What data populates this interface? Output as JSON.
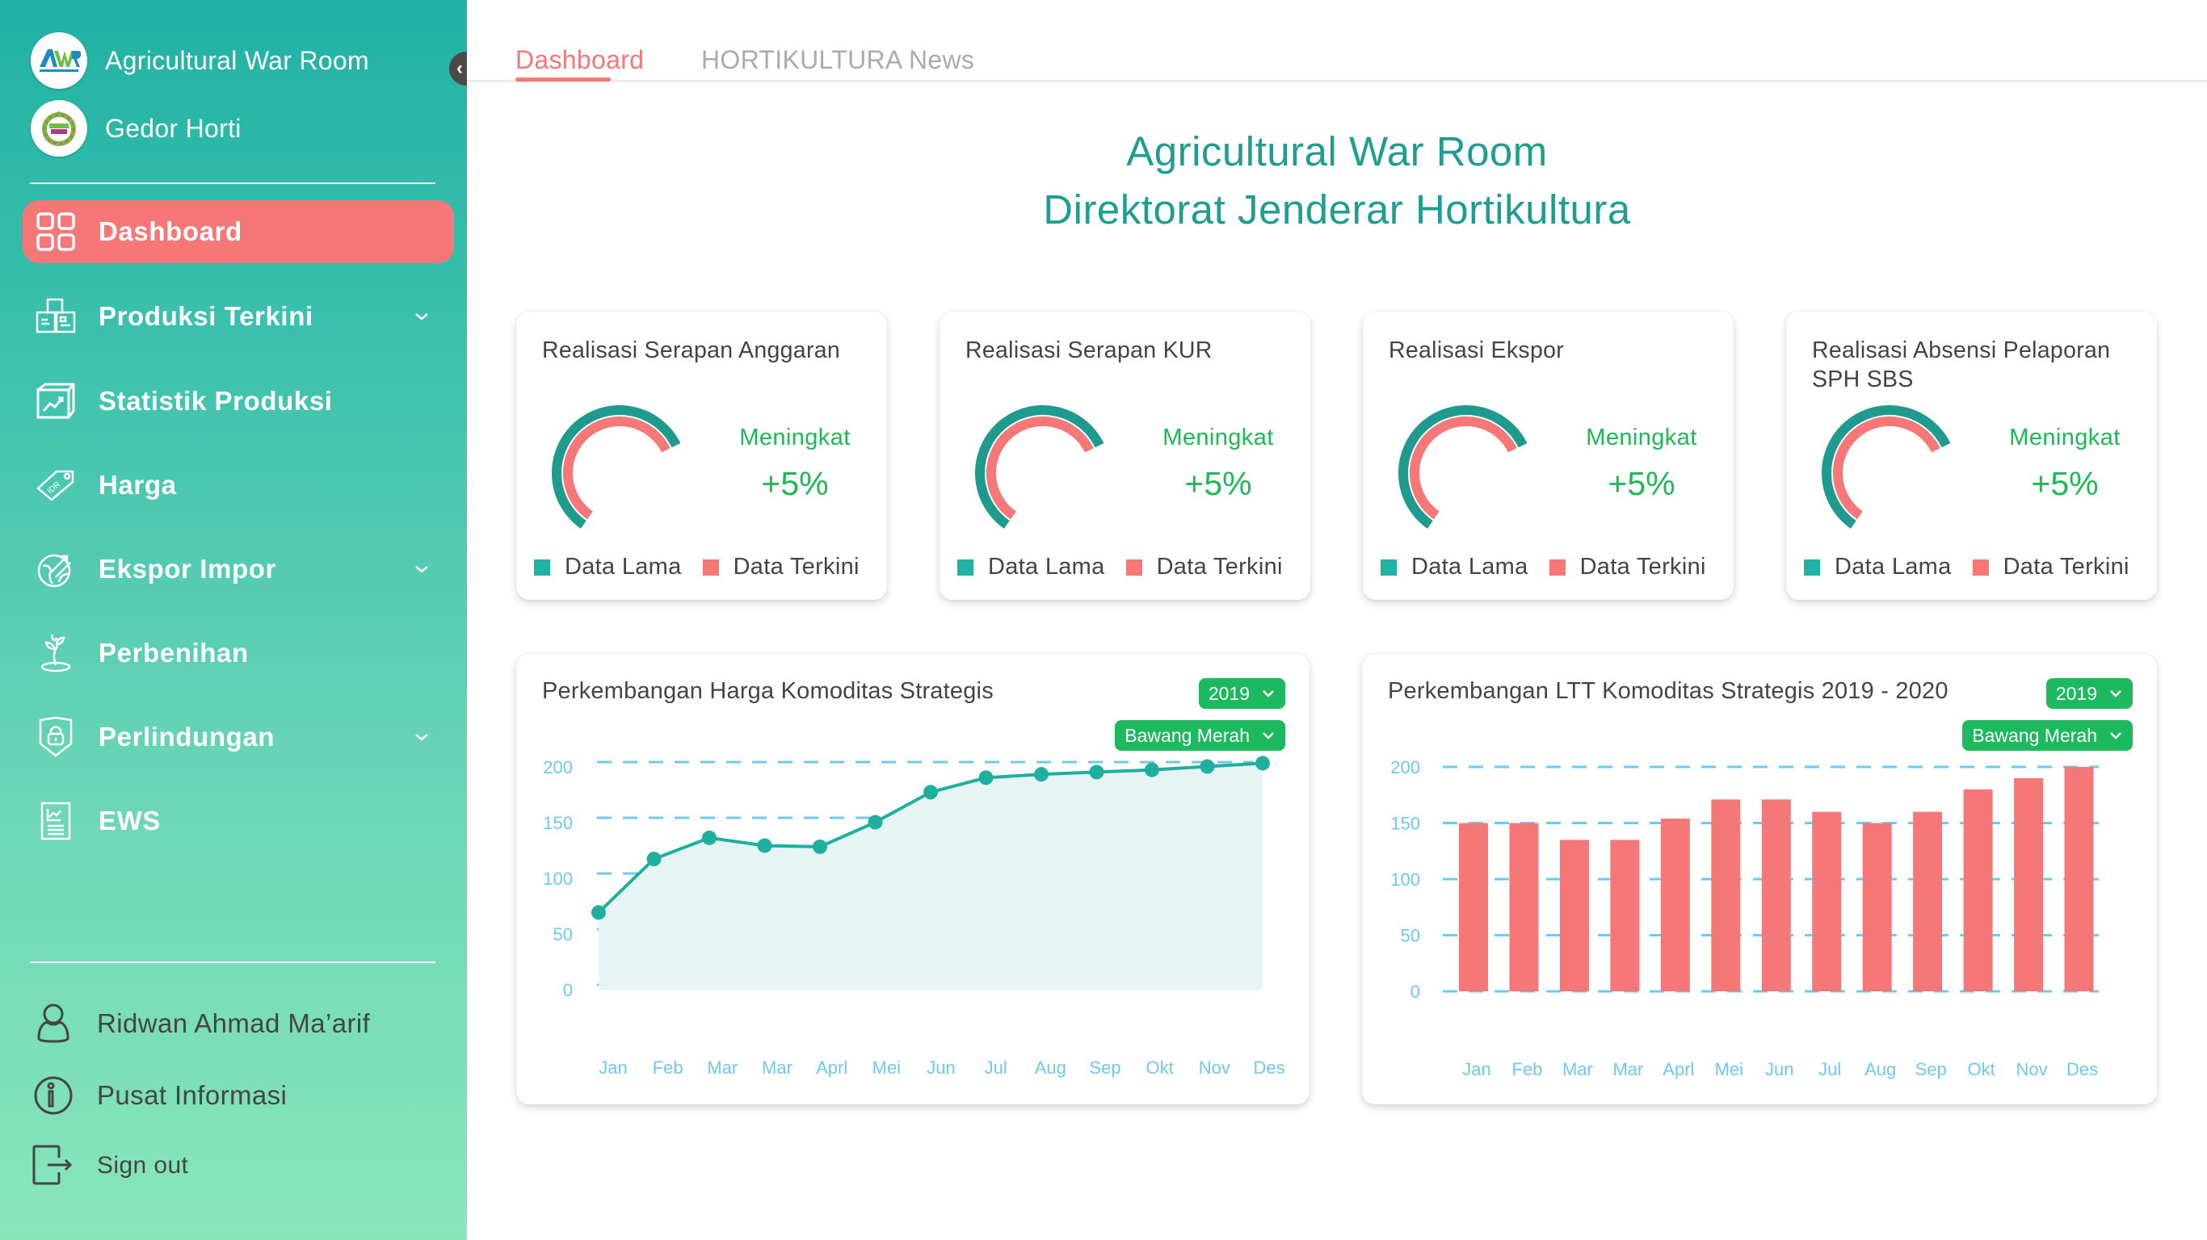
{
  "sidebar": {
    "brands": [
      {
        "name": "Agricultural War Room",
        "logo_text": "AWR",
        "icon": "awr-logo"
      },
      {
        "name": "Gedor Horti",
        "logo_text": "GEDOR HORTI",
        "icon": "gedor-horti-logo"
      }
    ],
    "collapse_icon": "chevron-left-icon",
    "nav": [
      {
        "label": "Dashboard",
        "icon": "dashboard-grid-icon",
        "active": true,
        "has_submenu": false
      },
      {
        "label": "Produksi Terkini",
        "icon": "boxes-icon",
        "active": false,
        "has_submenu": true
      },
      {
        "label": "Statistik Produksi",
        "icon": "chart-box-icon",
        "active": false,
        "has_submenu": false
      },
      {
        "label": "Harga",
        "icon": "price-tag-icon",
        "active": false,
        "has_submenu": false
      },
      {
        "label": "Ekspor Impor",
        "icon": "globe-arrows-icon",
        "active": false,
        "has_submenu": true
      },
      {
        "label": "Perbenihan",
        "icon": "seedling-icon",
        "active": false,
        "has_submenu": false
      },
      {
        "label": "Perlindungan",
        "icon": "shield-lock-icon",
        "active": false,
        "has_submenu": true
      },
      {
        "label": "EWS",
        "icon": "report-icon",
        "active": false,
        "has_submenu": false
      }
    ],
    "footer": [
      {
        "label": "Ridwan Ahmad Ma’arif",
        "icon": "user-icon"
      },
      {
        "label": "Pusat Informasi",
        "icon": "info-icon"
      },
      {
        "label": "Sign out",
        "icon": "sign-out-icon"
      }
    ]
  },
  "tabs": [
    {
      "label": "Dashboard",
      "active": true
    },
    {
      "label": "HORTIKULTURA News",
      "active": false
    }
  ],
  "header": {
    "title_line1": "Agricultural War Room",
    "title_line2": "Direktorat Jenderar Hortikultura"
  },
  "legend": {
    "old": "Data Lama",
    "new": "Data Terkini"
  },
  "colors": {
    "accent": "#F57777",
    "teal": "#1E9A8F",
    "teal_legend": "#20B2A5",
    "green": "#1DB954",
    "dropdown": "#1DB95E",
    "axis": "#6FC8EE"
  },
  "kpi_cards": [
    {
      "title": "Realisasi Serapan Anggaran",
      "status": "Meningkat",
      "change": "+5%",
      "old_fraction": 0.58,
      "new_fraction": 0.56
    },
    {
      "title": "Realisasi Serapan KUR",
      "status": "Meningkat",
      "change": "+5%",
      "old_fraction": 0.58,
      "new_fraction": 0.56
    },
    {
      "title": "Realisasi Ekspor",
      "status": "Meningkat",
      "change": "+5%",
      "old_fraction": 0.58,
      "new_fraction": 0.56
    },
    {
      "title": "Realisasi Absensi Pelaporan SPH SBS",
      "status": "Meningkat",
      "change": "+5%",
      "old_fraction": 0.58,
      "new_fraction": 0.56
    }
  ],
  "chart_data": [
    {
      "type": "area",
      "title": "Perkembangan Harga Komoditas Strategis",
      "year_select": "2019",
      "commodity_select": "Bawang Merah",
      "categories": [
        "Jan",
        "Feb",
        "Mar",
        "Mar",
        "Apri",
        "Mei",
        "Jun",
        "Jul",
        "Aug",
        "Sep",
        "Okt",
        "Nov",
        "Des"
      ],
      "tick_labels": [
        "Jan",
        "Feb",
        "Mar",
        "Mar",
        "Aprl",
        "Mei",
        "Jun",
        "Jul",
        "Aug",
        "Sep",
        "Okt",
        "Nov",
        "Des"
      ],
      "values": [
        65,
        113,
        132,
        125,
        124,
        146,
        173,
        186,
        189,
        191,
        193,
        196,
        199
      ],
      "yticks": [
        0,
        50,
        100,
        150,
        200
      ],
      "ylim": [
        0,
        200
      ],
      "grid": true,
      "line_color": "#1FAF9F",
      "fill_color": "#E6F5F3"
    },
    {
      "type": "bar",
      "title": "Perkembangan LTT Komoditas Strategis 2019 - 2020",
      "year_select": "2019",
      "commodity_select": "Bawang Merah",
      "categories": [
        "Jan",
        "Feb",
        "Mar",
        "Mar",
        "Aprl",
        "Mei",
        "Jun",
        "Jul",
        "Aug",
        "Sep",
        "Okt",
        "Nov",
        "Des"
      ],
      "tick_labels": [
        "Jan",
        "Feb",
        "Mar",
        "Mar",
        "Aprl",
        "Mei",
        "Jun",
        "Jul",
        "Aug",
        "Sep",
        "Okt",
        "Nov",
        "Des"
      ],
      "values": [
        150,
        150,
        135,
        135,
        154,
        171,
        171,
        160,
        150,
        160,
        180,
        190,
        200
      ],
      "yticks": [
        0,
        50,
        100,
        150,
        200
      ],
      "ylim": [
        0,
        200
      ],
      "grid": true,
      "bar_color": "#F57777"
    }
  ]
}
